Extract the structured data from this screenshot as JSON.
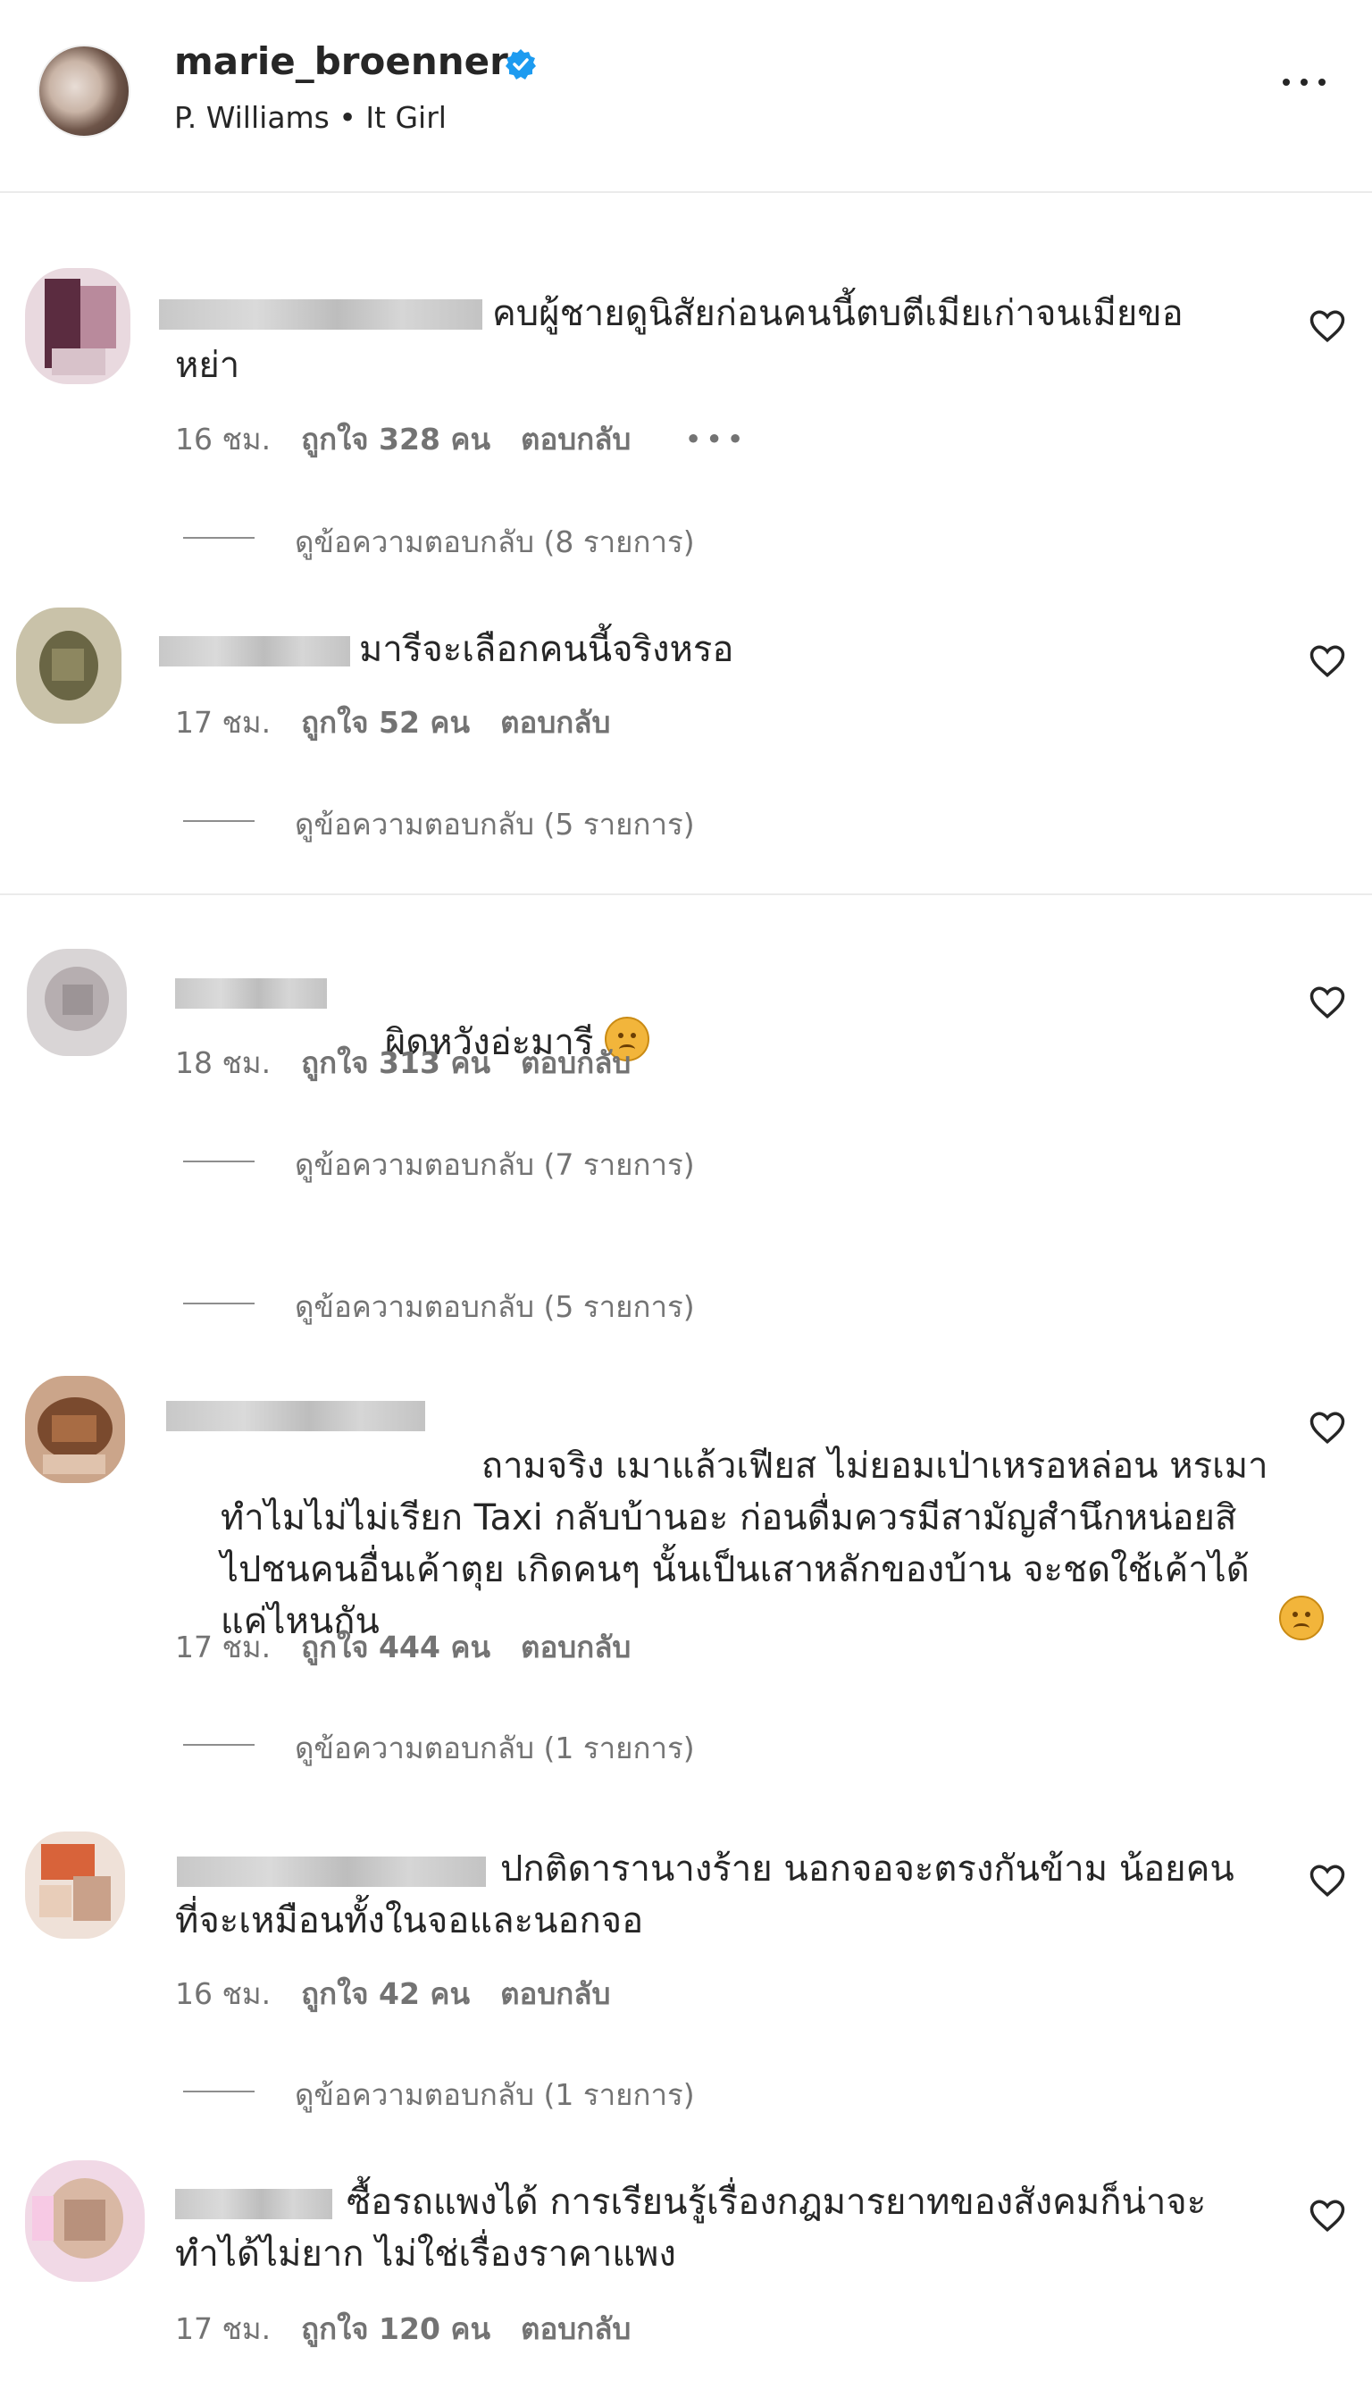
{
  "header": {
    "username": "marie_broenner",
    "subtitle": "P. Williams • It Girl"
  },
  "comments": [
    {
      "text": "คบผู้ชายดูนิสัยก่อนคนนี้ตบตีเมียเก่าจนเมียขอ\nหย่า",
      "time": "16 ชม.",
      "likes": "ถูกใจ 328 คน",
      "reply": "ตอบกลับ",
      "more": "•••",
      "view_replies": "ดูข้อความตอบกลับ (8 รายการ)"
    },
    {
      "text": "มารีจะเลือกคนนี้จริงหรอ",
      "time": "17 ชม.",
      "likes": "ถูกใจ 52 คน",
      "reply": "ตอบกลับ",
      "view_replies": "ดูข้อความตอบกลับ (5 รายการ)"
    },
    {
      "text": "ผิดหวังอ่ะมารี",
      "time": "18 ชม.",
      "likes": "ถูกใจ 313 คน",
      "reply": "ตอบกลับ",
      "view_replies": "ดูข้อความตอบกลับ (7 รายการ)",
      "view_replies_2": "ดูข้อความตอบกลับ (5 รายการ)"
    },
    {
      "text": "ถามจริง เมาแล้วเฟียส ไม่ยอมเป่าเหรอหล่อน หรเมา\nทำไมไม่ไม่เรียก Taxi กลับบ้านอะ ก่อนดื่มควรมีสามัญสำนึกหน่อยสิ\nไปชนคนอื่นเค้าตุย เกิดคนๆ นั้นเป็นเสาหลักของบ้าน จะชดใช้เค้าได้\nแค่ไหนกัน",
      "time": "17 ชม.",
      "likes": "ถูกใจ 444 คน",
      "reply": "ตอบกลับ",
      "view_replies": "ดูข้อความตอบกลับ (1 รายการ)"
    },
    {
      "text": "ปกติดารานางร้าย นอกจอจะตรงกันข้าม น้อยคน\nที่จะเหมือนทั้งในจอและนอกจอ",
      "time": "16 ชม.",
      "likes": "ถูกใจ 42 คน",
      "reply": "ตอบกลับ",
      "view_replies": "ดูข้อความตอบกลับ (1 รายการ)"
    },
    {
      "text": "ซื้อรถแพงได้ การเรียนรู้เรื่องกฎมารยาทของสังคมก็น่าจะ\nทำได้ไม่ยาก ไม่ใช่เรื่องราคาแพง",
      "time": "17 ชม.",
      "likes": "ถูกใจ 120 คน",
      "reply": "ตอบกลับ"
    }
  ]
}
